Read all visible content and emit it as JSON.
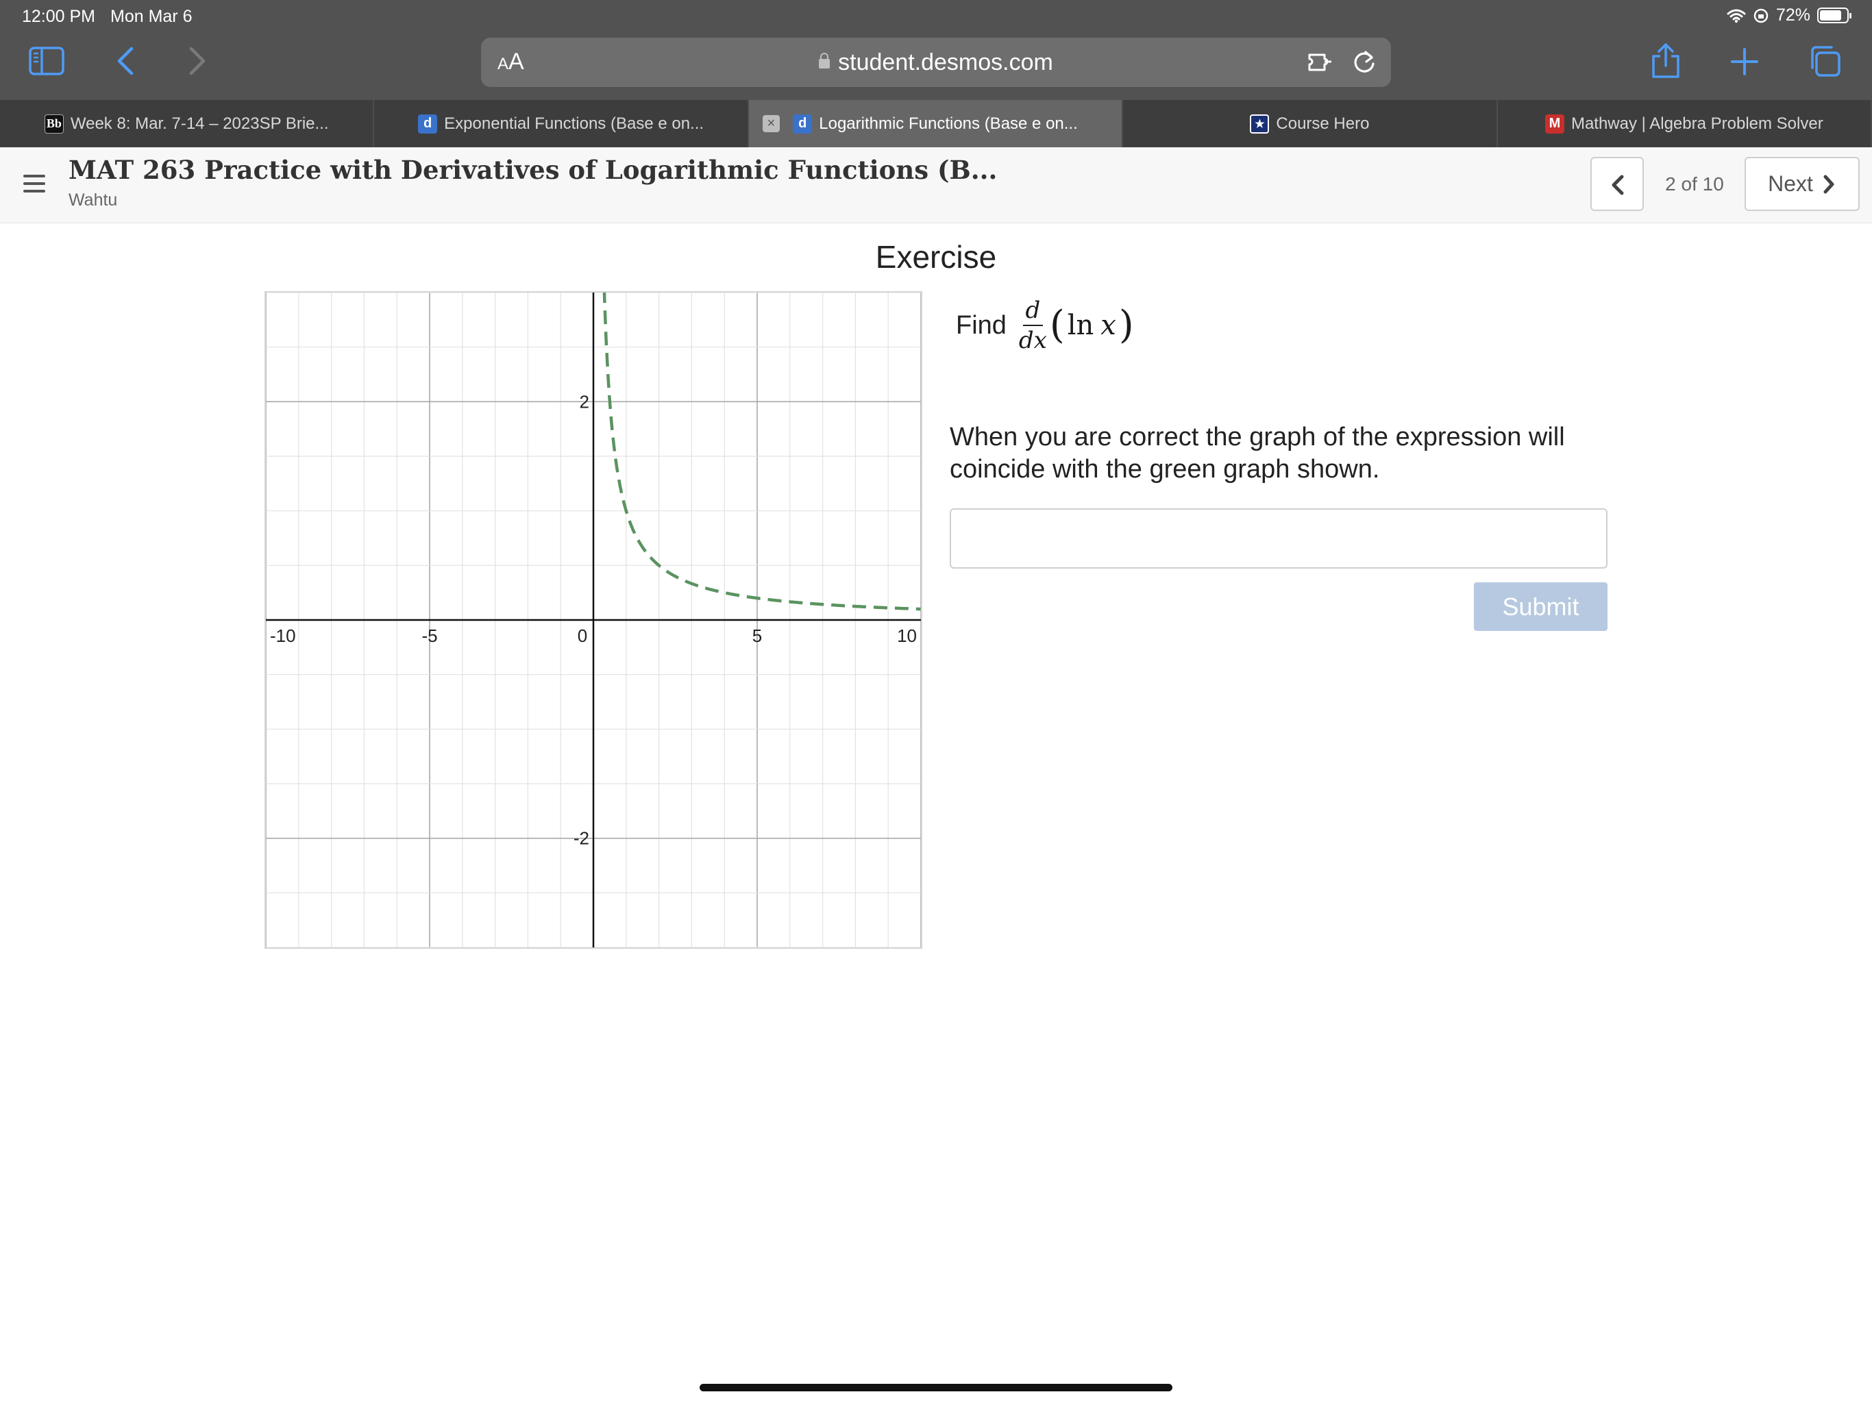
{
  "status_bar": {
    "time": "12:00 PM",
    "date": "Mon Mar 6",
    "battery": "72%"
  },
  "browser": {
    "address": {
      "aa_small": "A",
      "aa_large": "A",
      "url": "student.desmos.com"
    },
    "tabs": [
      {
        "label": "Week 8: Mar. 7-14 – 2023SP Brie...",
        "favicon": "Bb",
        "active": false
      },
      {
        "label": "Exponential Functions (Base e on...",
        "favicon": "d",
        "active": false
      },
      {
        "label": "Logarithmic Functions (Base e on...",
        "favicon": "d",
        "active": true,
        "close": "×"
      },
      {
        "label": "Course Hero",
        "favicon": "★",
        "active": false
      },
      {
        "label": "Mathway | Algebra Problem Solver",
        "favicon": "M",
        "active": false
      }
    ],
    "icons": [
      "sidebar-icon",
      "back-icon",
      "forward-icon",
      "extension-icon",
      "reload-icon",
      "share-icon",
      "new-tab-icon",
      "tab-overview-icon"
    ]
  },
  "header": {
    "title": "MAT 263 Practice with Derivatives of Logarithmic Functions (B...",
    "subtitle": "Wahtu",
    "page_count": "2 of 10",
    "next_label": "Next"
  },
  "exercise": {
    "title": "Exercise",
    "find_label": "Find",
    "math": {
      "numerator": "d",
      "denominator": "dx",
      "open_paren": "(",
      "func": "ln",
      "var": "x",
      "close_paren": ")"
    },
    "instructions": "When you are correct the graph of the expression will coincide with the green graph shown.",
    "input_value": "",
    "submit_label": "Submit"
  },
  "colors": {
    "chrome": "#525252",
    "tab_strip": "#3d3d3d",
    "active_tab": "#666666",
    "curve": "#5a9360",
    "submit_disabled": "#b6c9e0"
  },
  "chart_data": {
    "type": "line",
    "function": "1/x",
    "xlim": [
      -10,
      10
    ],
    "ylim": [
      -3,
      3
    ],
    "grid": true,
    "x_tick_labels": [
      "-10",
      "-5",
      "0",
      "5",
      "10"
    ],
    "y_tick_labels": [
      "2",
      "-2"
    ],
    "series": [
      {
        "style": "dashed",
        "color": "#5a9360",
        "x": [
          0.33,
          0.4,
          0.5,
          0.6,
          0.75,
          1,
          1.25,
          1.5,
          2,
          2.5,
          3,
          4,
          5,
          6,
          7,
          8,
          9,
          10
        ],
        "y": [
          3.03,
          2.5,
          2,
          1.667,
          1.333,
          1,
          0.8,
          0.667,
          0.5,
          0.4,
          0.333,
          0.25,
          0.2,
          0.167,
          0.143,
          0.125,
          0.111,
          0.1
        ]
      }
    ]
  }
}
